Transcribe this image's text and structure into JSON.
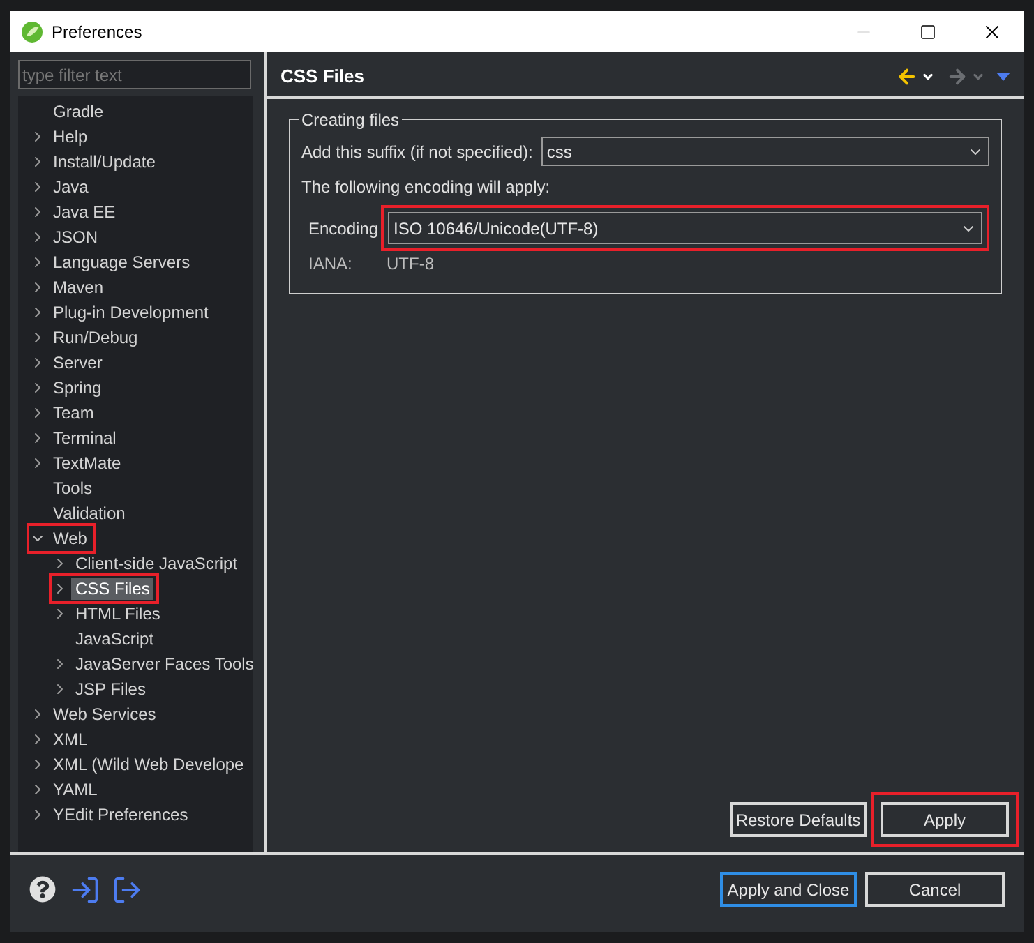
{
  "window": {
    "title": "Preferences"
  },
  "filter": {
    "placeholder": "type filter text"
  },
  "tree": [
    {
      "label": "Gradle",
      "kind": "leaf",
      "selected": false,
      "annotated": false
    },
    {
      "label": "Help",
      "kind": "folder",
      "expanded": false,
      "selected": false,
      "annotated": false
    },
    {
      "label": "Install/Update",
      "kind": "folder",
      "expanded": false,
      "selected": false,
      "annotated": false
    },
    {
      "label": "Java",
      "kind": "folder",
      "expanded": false,
      "selected": false,
      "annotated": false
    },
    {
      "label": "Java EE",
      "kind": "folder",
      "expanded": false,
      "selected": false,
      "annotated": false
    },
    {
      "label": "JSON",
      "kind": "folder",
      "expanded": false,
      "selected": false,
      "annotated": false
    },
    {
      "label": "Language Servers",
      "kind": "folder",
      "expanded": false,
      "selected": false,
      "annotated": false
    },
    {
      "label": "Maven",
      "kind": "folder",
      "expanded": false,
      "selected": false,
      "annotated": false
    },
    {
      "label": "Plug-in Development",
      "kind": "folder",
      "expanded": false,
      "selected": false,
      "annotated": false
    },
    {
      "label": "Run/Debug",
      "kind": "folder",
      "expanded": false,
      "selected": false,
      "annotated": false
    },
    {
      "label": "Server",
      "kind": "folder",
      "expanded": false,
      "selected": false,
      "annotated": false
    },
    {
      "label": "Spring",
      "kind": "folder",
      "expanded": false,
      "selected": false,
      "annotated": false
    },
    {
      "label": "Team",
      "kind": "folder",
      "expanded": false,
      "selected": false,
      "annotated": false
    },
    {
      "label": "Terminal",
      "kind": "folder",
      "expanded": false,
      "selected": false,
      "annotated": false
    },
    {
      "label": "TextMate",
      "kind": "folder",
      "expanded": false,
      "selected": false,
      "annotated": false
    },
    {
      "label": "Tools",
      "kind": "leaf",
      "selected": false,
      "annotated": false
    },
    {
      "label": "Validation",
      "kind": "leaf",
      "selected": false,
      "annotated": false
    },
    {
      "label": "Web",
      "kind": "folder",
      "expanded": true,
      "selected": false,
      "annotated": true,
      "children": [
        {
          "label": "Client-side JavaScript",
          "kind": "folder",
          "expanded": false,
          "selected": false,
          "annotated": false
        },
        {
          "label": "CSS Files",
          "kind": "folder",
          "expanded": false,
          "selected": true,
          "annotated": true
        },
        {
          "label": "HTML Files",
          "kind": "folder",
          "expanded": false,
          "selected": false,
          "annotated": false
        },
        {
          "label": "JavaScript",
          "kind": "leaf",
          "selected": false,
          "annotated": false
        },
        {
          "label": "JavaServer Faces Tools",
          "kind": "folder",
          "expanded": false,
          "selected": false,
          "annotated": false
        },
        {
          "label": "JSP Files",
          "kind": "folder",
          "expanded": false,
          "selected": false,
          "annotated": false
        }
      ]
    },
    {
      "label": "Web Services",
      "kind": "folder",
      "expanded": false,
      "selected": false,
      "annotated": false
    },
    {
      "label": "XML",
      "kind": "folder",
      "expanded": false,
      "selected": false,
      "annotated": false
    },
    {
      "label": "XML (Wild Web Develope",
      "kind": "folder",
      "expanded": false,
      "selected": false,
      "annotated": false
    },
    {
      "label": "YAML",
      "kind": "folder",
      "expanded": false,
      "selected": false,
      "annotated": false
    },
    {
      "label": "YEdit Preferences",
      "kind": "folder",
      "expanded": false,
      "selected": false,
      "annotated": false
    }
  ],
  "page": {
    "title": "CSS Files",
    "group": {
      "legend": "Creating files",
      "suffix": {
        "label": "Add this suffix (if not specified):",
        "value": "css"
      },
      "note": "The following encoding will apply:",
      "encoding": {
        "label": "Encoding",
        "value": "ISO 10646/Unicode(UTF-8)",
        "annotated": true
      },
      "iana": {
        "label": "IANA:",
        "value": "UTF-8"
      }
    },
    "buttons": [
      {
        "label": "Restore Defaults",
        "annotated": false
      },
      {
        "label": "Apply",
        "annotated": true
      }
    ]
  },
  "footer": {
    "buttons": [
      {
        "label": "Apply and Close",
        "default": true
      },
      {
        "label": "Cancel",
        "default": false
      }
    ]
  }
}
